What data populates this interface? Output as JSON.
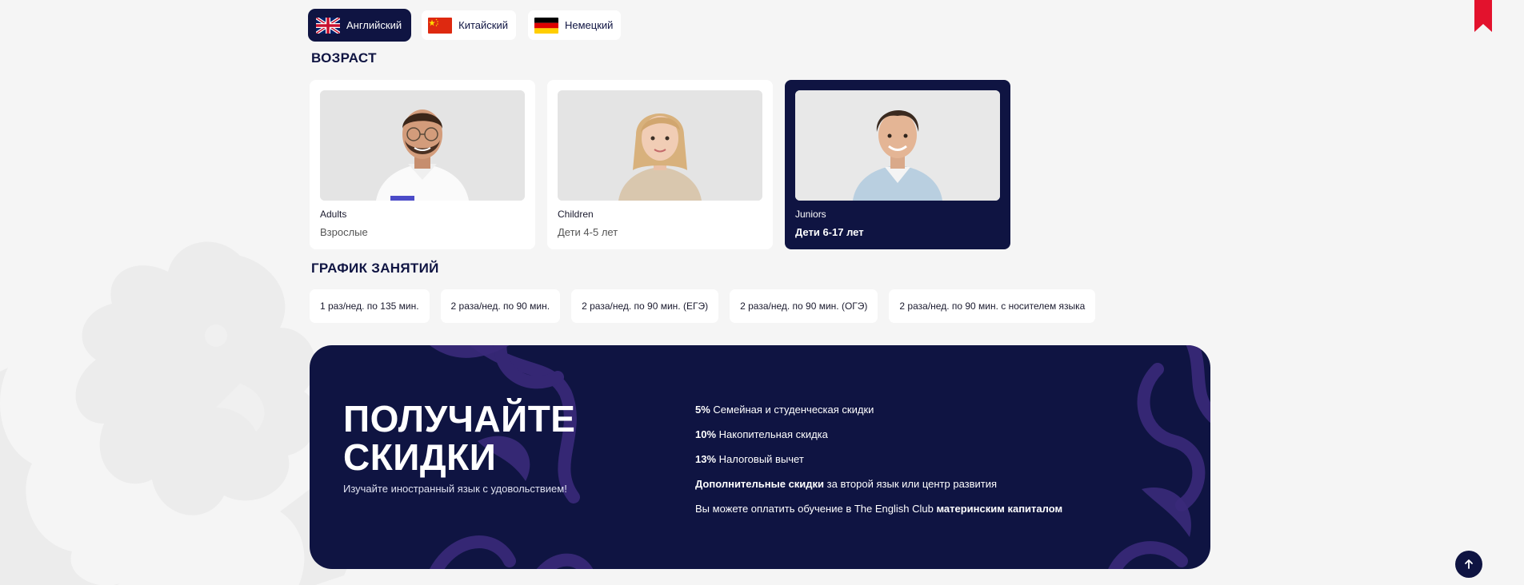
{
  "languages": [
    {
      "label": "Английский",
      "icon": "uk-flag-icon",
      "active": true
    },
    {
      "label": "Китайский",
      "icon": "china-flag-icon",
      "active": false
    },
    {
      "label": "Немецкий",
      "icon": "germany-flag-icon",
      "active": false
    }
  ],
  "age_section": {
    "title": "ВОЗРАСТ",
    "cards": [
      {
        "name": "Adults",
        "desc": "Взрослые",
        "active": false
      },
      {
        "name": "Children",
        "desc": "Дети 4-5 лет",
        "active": false
      },
      {
        "name": "Juniors",
        "desc": "Дети 6-17 лет",
        "active": true
      }
    ]
  },
  "schedule_section": {
    "title": "ГРАФИК ЗАНЯТИЙ",
    "options": [
      "1 раз/нед. по 135 мин.",
      "2 раза/нед. по 90 мин.",
      "2 раза/нед. по 90 мин. (ЕГЭ)",
      "2 раза/нед. по 90 мин. (ОГЭ)",
      "2 раза/нед. по 90 мин. с носителем языка"
    ]
  },
  "promo": {
    "title_line1": "ПОЛУЧАЙТЕ",
    "title_line2": "СКИДКИ",
    "subtitle": "Изучайте иностранный язык с удовольствием!",
    "items": [
      {
        "bold": "5%",
        "text": " Семейная и студенческая скидки"
      },
      {
        "bold": "10%",
        "text": " Накопительная скидка"
      },
      {
        "bold": "13%",
        "text": " Налоговый вычет"
      },
      {
        "bold": "Дополнительные скидки",
        "text": " за второй язык или центр развития"
      }
    ],
    "last_item_text": "Вы можете оплатить обучение в The English Club ",
    "last_item_bold": "материнским капиталом"
  },
  "colors": {
    "navy": "#0f1442",
    "accent_red": "#e3122d",
    "promo_pattern": "#3a2a7a",
    "background": "#f5f5f5"
  },
  "icons": {
    "bookmark": "bookmark-icon",
    "scroll_top": "arrow-up-icon"
  }
}
